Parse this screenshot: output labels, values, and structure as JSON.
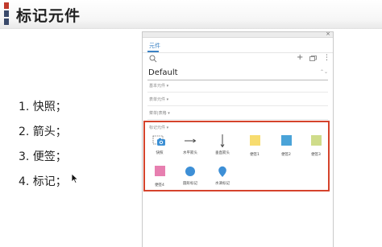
{
  "header": {
    "title": "标记元件",
    "bar_colors": [
      "#c0392b",
      "#3a4a6b",
      "#3a4a6b"
    ]
  },
  "list": {
    "items": [
      "1. 快照；",
      "2. 箭头；",
      "3. 便签；",
      "4. 标记；"
    ]
  },
  "panel": {
    "close_glyph": "×",
    "tab_label": "元件",
    "toolbar": {
      "plus_glyph": "+",
      "more_glyph": "⋮"
    },
    "select": {
      "value": "Default",
      "caret": "⌃⌄"
    },
    "sections": [
      "基本元件 ▾",
      "表单元件 ▾",
      "菜单|表格 ▾"
    ],
    "marker_group": {
      "label": "标记元件 ▾",
      "items": [
        {
          "label": "快照",
          "icon": "snapshot-icon"
        },
        {
          "label": "水平箭头",
          "icon": "arrow-right-icon"
        },
        {
          "label": "垂直箭头",
          "icon": "arrow-down-icon"
        },
        {
          "label": "便签1",
          "icon": "sticky-note-icon",
          "color": "#f7dc6f"
        },
        {
          "label": "便签2",
          "icon": "sticky-note-icon",
          "color": "#4aa3d8"
        },
        {
          "label": "便签3",
          "icon": "sticky-note-icon",
          "color": "#cfdc8a"
        },
        {
          "label": "便签4",
          "icon": "sticky-note-icon",
          "color": "#e77fb0"
        },
        {
          "label": "圆形标记",
          "icon": "circle-marker-icon",
          "color": "#3d8fd6"
        },
        {
          "label": "水滴标记",
          "icon": "drop-marker-icon",
          "color": "#3d8fd6"
        }
      ]
    },
    "highlight_color": "#d5432c",
    "accent_color": "#3b82c4"
  }
}
